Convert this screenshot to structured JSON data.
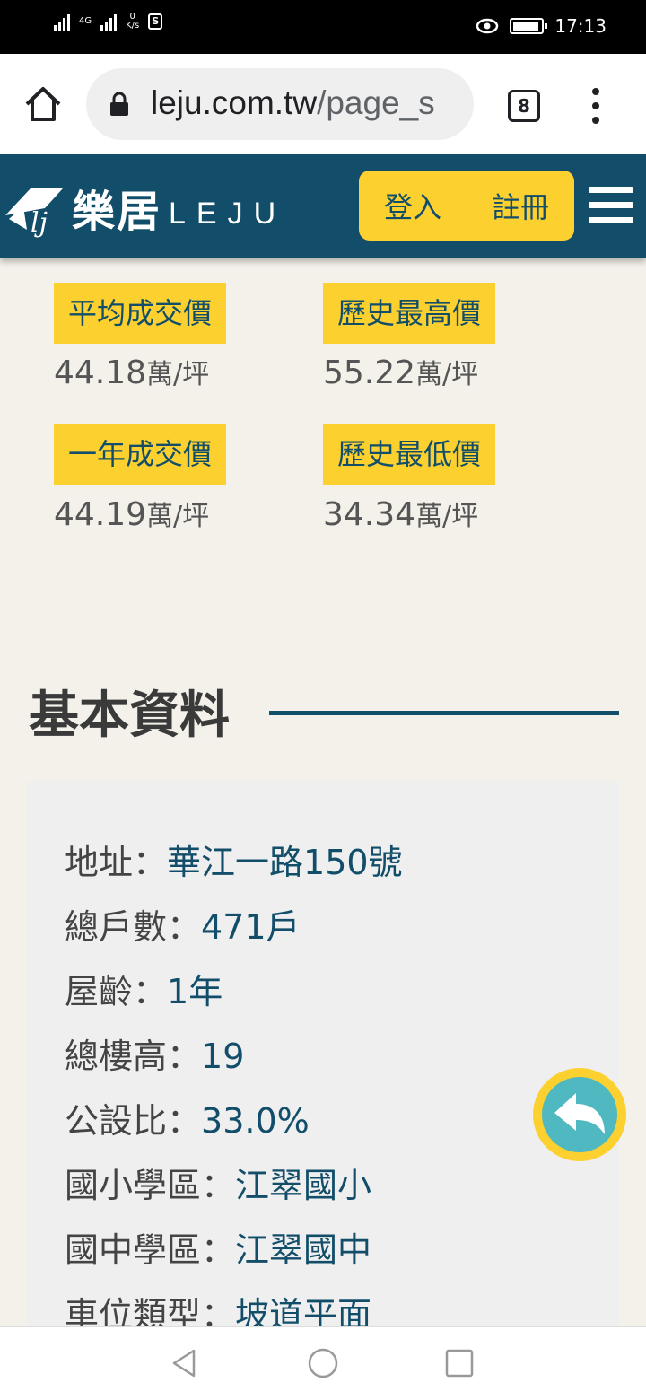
{
  "status_bar": {
    "network": "4G",
    "speed_value": "0",
    "speed_unit": "K/s",
    "time": "17:13"
  },
  "browser": {
    "url_host": "leju.com.tw",
    "url_path": "/page_s",
    "tab_count": "8"
  },
  "header": {
    "logo_cn": "樂居",
    "logo_en": "LEJU",
    "login_label": "登入",
    "register_label": "註冊"
  },
  "prices": {
    "avg": {
      "label": "平均成交價",
      "value": "44.18",
      "unit": "萬/坪"
    },
    "hist_high": {
      "label": "歷史最高價",
      "value": "55.22",
      "unit": "萬/坪"
    },
    "year": {
      "label": "一年成交價",
      "value": "44.19",
      "unit": "萬/坪"
    },
    "hist_low": {
      "label": "歷史最低價",
      "value": "34.34",
      "unit": "萬/坪"
    }
  },
  "basic_info": {
    "title": "基本資料",
    "rows": [
      {
        "label": "地址：",
        "value": "華江一路150號"
      },
      {
        "label": "總戶數：",
        "value": "471戶"
      },
      {
        "label": "屋齡：",
        "value": "1年"
      },
      {
        "label": "總樓高：",
        "value": "19"
      },
      {
        "label": "公設比：",
        "value": "33.0%"
      },
      {
        "label": "國小學區：",
        "value": "江翠國小"
      },
      {
        "label": "國中學區：",
        "value": "江翠國中"
      },
      {
        "label": "車位類型：",
        "value": "坡道平面"
      }
    ]
  },
  "colors": {
    "brand": "#124e6a",
    "accent": "#fcd12f",
    "fab": "#4fb8c0",
    "background": "#f3f1ea"
  },
  "icons": {
    "home": "home-icon",
    "lock": "lock-icon",
    "menu": "more-vert-icon",
    "hamburger": "hamburger-icon",
    "back": "reply-arrow-icon"
  }
}
